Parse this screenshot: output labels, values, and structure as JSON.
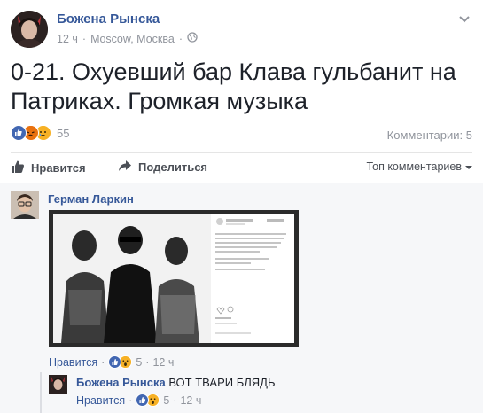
{
  "post": {
    "author": "Божена Рынска",
    "time": "12 ч",
    "location": "Moscow, Москва",
    "text": "0-21. Охуевший бар Клава гульбанит на Патриках. Громкая музыка",
    "reaction_icons": [
      "like-icon",
      "angry-icon",
      "sad-icon"
    ],
    "reaction_count": "55",
    "comments_label": "Комментарии: 5"
  },
  "actions": {
    "like": "Нравится",
    "share": "Поделиться",
    "sort": "Топ комментариев"
  },
  "comments": [
    {
      "author": "Герман Ларкин",
      "like_label": "Нравится",
      "reaction_icons": [
        "like-icon",
        "wow-icon"
      ],
      "reaction_count": "5",
      "time": "12 ч",
      "attachment_icon": "photo-icon"
    }
  ],
  "reply": {
    "author": "Божена Рынска",
    "text": "ВОТ ТВАРИ БЛЯДЬ",
    "like_label": "Нравится",
    "reaction_icons": [
      "like-icon",
      "wow-icon"
    ],
    "reaction_count": "5",
    "time": "12 ч"
  },
  "colors": {
    "link": "#365899",
    "meta": "#90949c",
    "text": "#1d2129",
    "like": "#4267b2",
    "angry": "#e9710f",
    "sad": "#f7b125",
    "comments_bg": "#f6f7f9"
  }
}
